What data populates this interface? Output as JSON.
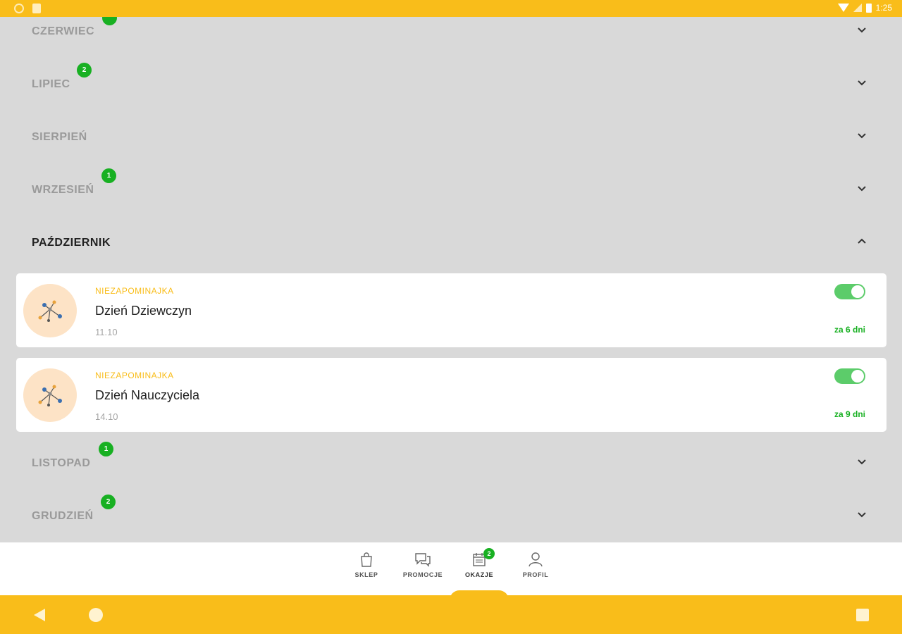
{
  "status_bar": {
    "time": "1:25"
  },
  "months": [
    {
      "label": "CZERWIEC",
      "badge": "",
      "expanded": false
    },
    {
      "label": "LIPIEC",
      "badge": "2",
      "expanded": false
    },
    {
      "label": "SIERPIEŃ",
      "badge": "",
      "expanded": false
    },
    {
      "label": "WRZESIEŃ",
      "badge": "1",
      "expanded": false
    },
    {
      "label": "PAŹDZIERNIK",
      "badge": "",
      "expanded": true
    },
    {
      "label": "LISTOPAD",
      "badge": "1",
      "expanded": false
    },
    {
      "label": "GRUDZIEŃ",
      "badge": "2",
      "expanded": false
    }
  ],
  "events": [
    {
      "category": "NIEZAPOMINAJKA",
      "title": "Dzień Dziewczyn",
      "date": "11.10",
      "countdown": "za 6 dni",
      "enabled": true,
      "icon": "flowers-icon"
    },
    {
      "category": "NIEZAPOMINAJKA",
      "title": "Dzień Nauczyciela",
      "date": "14.10",
      "countdown": "za 9 dni",
      "enabled": true,
      "icon": "flowers-icon"
    }
  ],
  "bottom_nav": {
    "items": [
      {
        "label": "SKLEP",
        "icon": "shopping-bag-icon"
      },
      {
        "label": "PROMOCJE",
        "icon": "chat-bubbles-icon"
      },
      {
        "label": "OKAZJE",
        "icon": "calendar-icon",
        "badge": "2",
        "active": true
      },
      {
        "label": "PROFIL",
        "icon": "person-icon"
      }
    ]
  },
  "colors": {
    "brand": "#f9bd1a",
    "badge": "#18b022",
    "toggle_on": "#5ccc6a",
    "avatar_bg": "#fde3c6"
  }
}
